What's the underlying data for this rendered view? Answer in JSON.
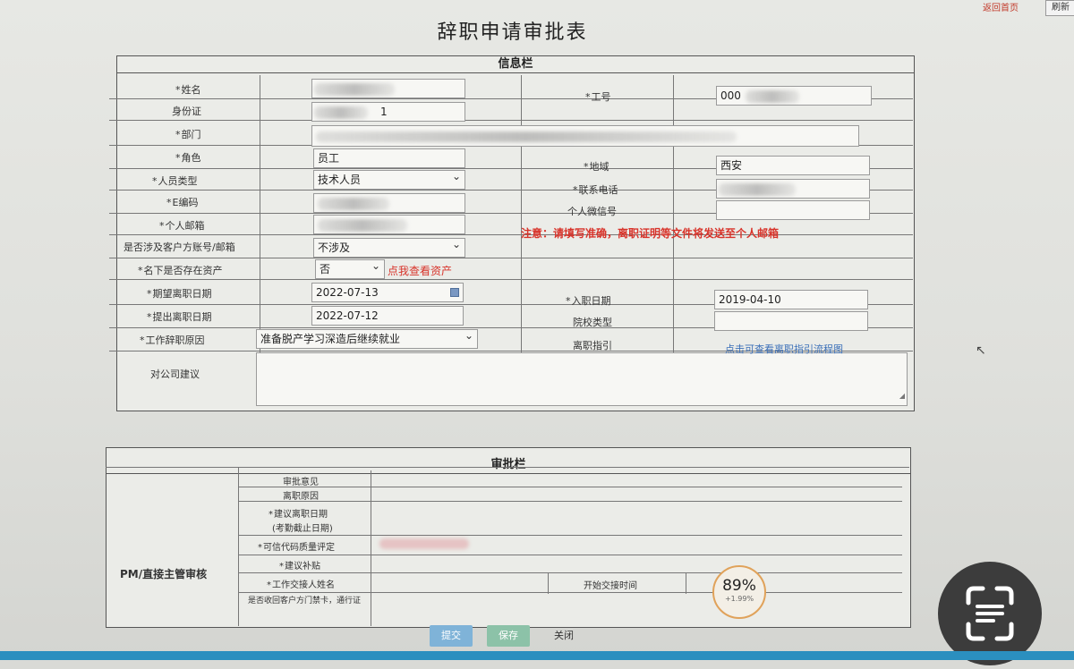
{
  "topbar": {
    "link": "返回首页",
    "button": "刷新"
  },
  "title": "辞职申请审批表",
  "info": {
    "header": "信息栏",
    "name_label": "姓名",
    "idcard_label": "身份证",
    "idcard_value": "1",
    "dept_label": "部门",
    "role_label": "角色",
    "role_value": "员工",
    "staff_type_label": "人员类型",
    "staff_type_value": "技术人员",
    "eid_label": "E编码",
    "email_label": "个人邮箱",
    "customer_label": "是否涉及客户方账号/邮箱",
    "customer_value": "不涉及",
    "asset_label": "名下是否存在资产",
    "asset_value": "否",
    "asset_link": "点我查看资产",
    "expect_date_label": "期望离职日期",
    "expect_date_value": "2022-07-13",
    "submit_date_label": "提出离职日期",
    "submit_date_value": "2022-07-12",
    "reason_label": "工作辞职原因",
    "reason_value": "准备脱产学习深造后继续就业",
    "suggest_label": "对公司建议",
    "workno_label": "工号",
    "workno_value": "000",
    "region_label": "地域",
    "region_value": "西安",
    "phone_label": "联系电话",
    "wechat_label": "个人微信号",
    "notice": "注意：请填写准确，离职证明等文件将发送至个人邮箱",
    "entry_date_label": "入职日期",
    "entry_date_value": "2019-04-10",
    "school_type_label": "院校类型",
    "guide_label": "离职指引",
    "guide_link": "点击可查看离职指引流程图"
  },
  "approval": {
    "header": "审批栏",
    "pm_label": "PM/直接主管审核",
    "rows": [
      "审批意见",
      "离职原因",
      "建议离职日期",
      "(考勤截止日期)",
      "可信代码质量评定",
      "建议补贴",
      "工作交接人姓名",
      "是否收回客户方门禁卡，通行证"
    ],
    "handover_time_label": "开始交接时间"
  },
  "badge": {
    "percent": "89%",
    "sub": "+1.99%"
  },
  "buttons": {
    "submit": "提交",
    "save": "保存",
    "close": "关闭"
  },
  "colors": {
    "submit": "#7fb3d8",
    "save": "#8cc2a8",
    "notice": "#d8332a",
    "link": "#3b6fb8"
  }
}
